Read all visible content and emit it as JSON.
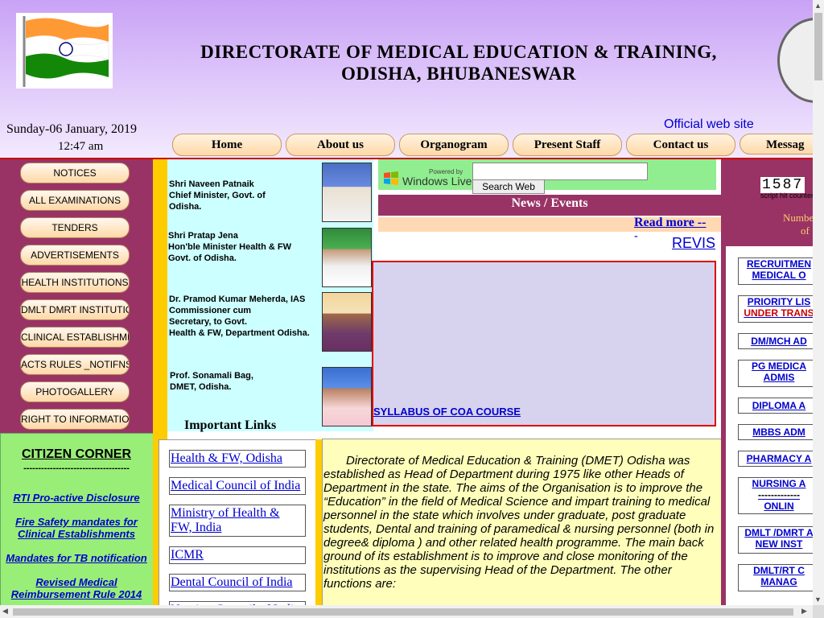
{
  "header": {
    "title_line1": "DIRECTORATE OF MEDICAL EDUCATION & TRAINING,",
    "title_line2": "ODISHA, BHUBANESWAR",
    "date": "Sunday-06 January, 2019",
    "time": "12:47 am",
    "official_site": "Official web site"
  },
  "nav": [
    "Home",
    "About us",
    "Organogram",
    "Present Staff",
    "Contact us",
    "Messag"
  ],
  "left_menu": [
    "NOTICES",
    "ALL EXAMINATIONS",
    "TENDERS",
    "ADVERTISEMENTS",
    "HEALTH INSTITUTIONS",
    "DMLT DMRT INSTITUTIONS",
    "CLINICAL ESTABLISHMENT",
    "ACTS  RULES _NOTIFNS",
    "PHOTOGALLERY",
    "RIGHT TO INFORMATION"
  ],
  "citizen_corner": {
    "title": "CITIZEN CORNER",
    "divider": "------------------------------------",
    "items": [
      "RTI Pro-active Disclosure",
      "Fire Safety mandates for Clinical Establishments",
      "Mandates for TB notification",
      "Revised Medical Reimbursement Rule 2014"
    ]
  },
  "officials": [
    {
      "lines": [
        "Shri Naveen Patnaik",
        "Chief Minister, Govt. of",
        "Odisha."
      ]
    },
    {
      "lines": [
        "Shri Pratap Jena",
        "Hon'ble Minister Health & FW",
        "Govt. of Odisha."
      ]
    },
    {
      "lines": [
        "Dr. Pramod Kumar Meherda, IAS",
        "Commissioner cum",
        "Secretary, to Govt.",
        "Health & FW, Department Odisha."
      ]
    },
    {
      "lines": [
        "Prof. Sonamali Bag,",
        "DMET,  Odisha."
      ]
    }
  ],
  "important_links": {
    "title": "Important Links",
    "items": [
      "Health & FW, Odisha",
      "Medical Council of India",
      "Ministry of Health & FW, India",
      "ICMR",
      "Dental Council of India",
      "Nursing Council of India"
    ]
  },
  "search": {
    "powered_by": "Powered by",
    "brand": "Windows Live",
    "button": "Search Web",
    "input_value": ""
  },
  "news": {
    "header": "News / Events",
    "read_more": "Read more --",
    "read_more_dash": "-",
    "revis": "REVIS",
    "item": "SYLLABUS OF COA COURSE"
  },
  "about_text": "Directorate of Medical Education & Training (DMET) Odisha was established as Head of Department during 1975 like other Heads of Department in the state. The aims of the Organisation is to improve the “Education” in the field of Medical Science and impart training to medical personnel in the state which involves under graduate, post graduate students, Dental and training of paramedical & nursing personnel (both in degree& diploma ) and other related health programme. The main back ground of its establishment is to improve and close monitoring of the institutions as the supervising Head of the Department. The other functions are:",
  "counter": {
    "digits": "1587",
    "label": "script hit counter",
    "number_line1": "Numbe",
    "number_line2": "of"
  },
  "right_items": [
    {
      "line1": "RECRUITMEN",
      "line2": "MEDICAL O",
      "red": ""
    },
    {
      "line1": "PRIORITY LIS",
      "line2": "",
      "red": "UNDER TRANS"
    },
    {
      "line1": "DM/MCH AD",
      "line2": "",
      "red": ""
    },
    {
      "line1": "PG MEDICA",
      "line2": "ADMIS",
      "red": ""
    },
    {
      "line1": "DIPLOMA A",
      "line2": "",
      "red": ""
    },
    {
      "line1": "MBBS ADM",
      "line2": "",
      "red": ""
    },
    {
      "line1": "PHARMACY A",
      "line2": "",
      "red": ""
    },
    {
      "line1": "NURSING A",
      "line2": "-------------",
      "line3": "ONLIN"
    },
    {
      "line1": "DMLT /DMRT A",
      "line2": "NEW INST",
      "red": ""
    },
    {
      "line1": "DMLT/RT C",
      "line2": "MANAG",
      "red": ""
    }
  ],
  "colors": {
    "accent": "#993366",
    "header_bg": "#c9a2f5",
    "citizen_bg": "#99ee77",
    "yellow": "#ffcc00"
  }
}
